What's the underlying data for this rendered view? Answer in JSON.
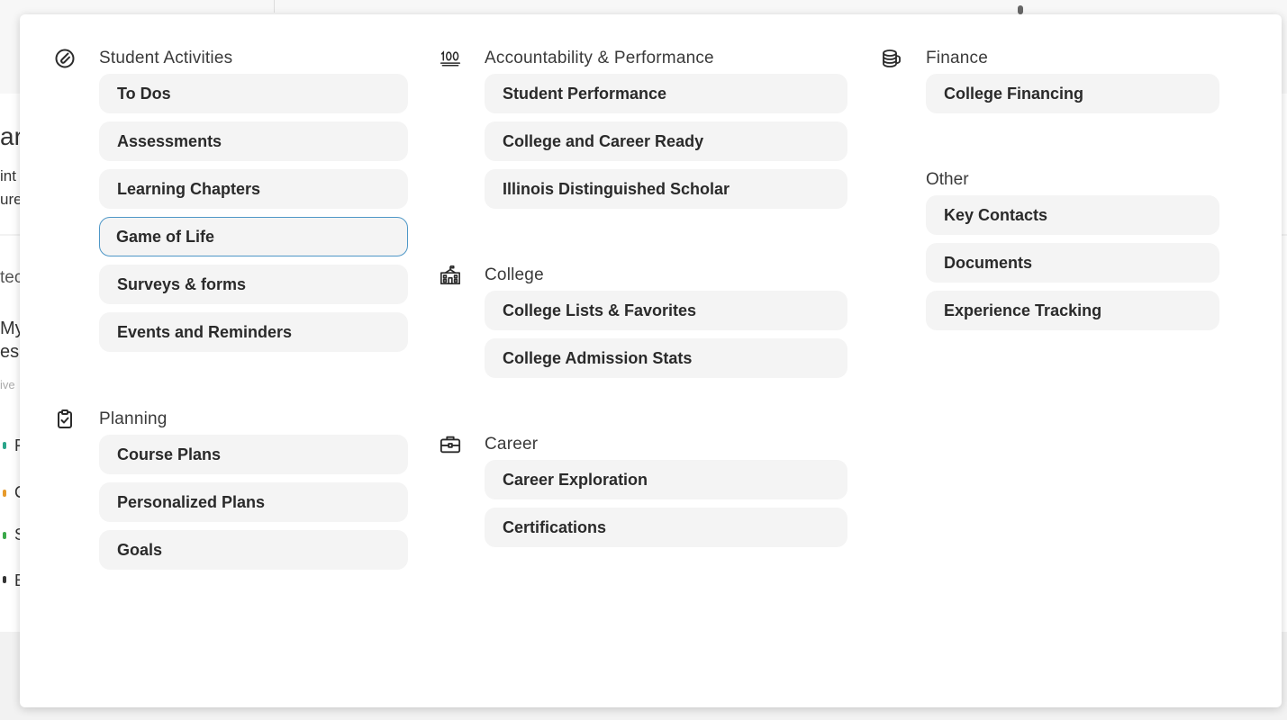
{
  "menu": {
    "columns": [
      {
        "sections": [
          {
            "id": "student-activities",
            "icon": "paperclip-pen-icon",
            "title": "Student Activities",
            "items": [
              {
                "label": "To Dos"
              },
              {
                "label": "Assessments"
              },
              {
                "label": "Learning Chapters"
              },
              {
                "label": "Game of Life",
                "focused": true
              },
              {
                "label": "Surveys & forms"
              },
              {
                "label": "Events and Reminders"
              }
            ]
          },
          {
            "id": "planning",
            "icon": "clipboard-check-icon",
            "title": "Planning",
            "items": [
              {
                "label": "Course Plans"
              },
              {
                "label": "Personalized Plans"
              },
              {
                "label": "Goals"
              }
            ]
          }
        ]
      },
      {
        "sections": [
          {
            "id": "accountability",
            "icon": "hundred-points-icon",
            "title": "Accountability & Performance",
            "items": [
              {
                "label": "Student Performance"
              },
              {
                "label": "College and Career Ready"
              },
              {
                "label": "Illinois Distinguished Scholar"
              }
            ]
          },
          {
            "id": "college",
            "icon": "school-building-icon",
            "title": "College",
            "items": [
              {
                "label": "College Lists & Favorites"
              },
              {
                "label": "College Admission Stats"
              }
            ]
          },
          {
            "id": "career",
            "icon": "briefcase-icon",
            "title": "Career",
            "items": [
              {
                "label": "Career Exploration"
              },
              {
                "label": "Certifications"
              }
            ]
          }
        ]
      },
      {
        "sections": [
          {
            "id": "finance",
            "icon": "coin-stack-icon",
            "title": "Finance",
            "items": [
              {
                "label": "College Financing"
              }
            ]
          },
          {
            "id": "other",
            "title": "Other",
            "items": [
              {
                "label": "Key Contacts"
              },
              {
                "label": "Documents"
              },
              {
                "label": "Experience Tracking"
              }
            ]
          }
        ]
      }
    ]
  },
  "background": {
    "fragments": [
      "ar",
      "int",
      "ure",
      "tec",
      "My",
      "es",
      "ive",
      "F",
      "C",
      "S",
      "E"
    ],
    "colors": {
      "teal": "#2aa58a",
      "orange": "#e79a2b",
      "green": "#3aa84a",
      "dark": "#333333"
    }
  },
  "colors": {
    "panel_bg": "#ffffff",
    "item_bg": "#f4f4f4",
    "focus_border": "#4e97c7",
    "text": "#2a2a2a"
  }
}
